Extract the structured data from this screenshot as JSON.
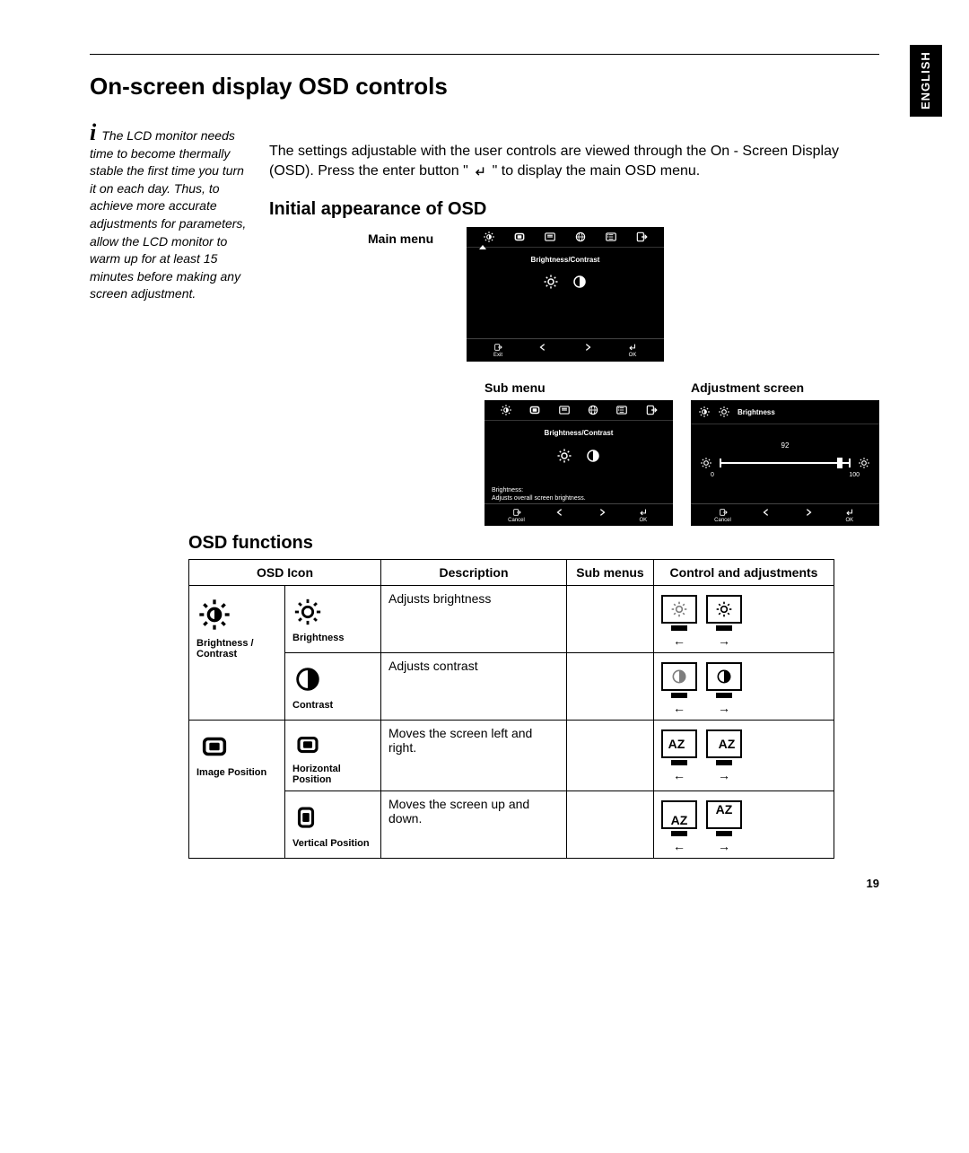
{
  "lang_tab": "ENGLISH",
  "page_title": "On-screen display OSD controls",
  "sidebar_note": "The LCD monitor needs time to become thermally stable the first time you turn it on each day. Thus, to achieve more accurate adjustments for parameters, allow the LCD monitor to warm up for  at least 15 minutes before making any screen adjustment.",
  "intro_text_1": "The settings adjustable with the user controls are viewed through the On - Screen Display (OSD). Press the enter button \" ",
  "intro_text_2": " \" to display the main OSD menu.",
  "section_initial": "Initial appearance of OSD",
  "label_main_menu": "Main menu",
  "label_sub_menu": "Sub menu",
  "label_adjustment": "Adjustment screen",
  "osd_main": {
    "title": "Brightness/Contrast",
    "exit": "Exit",
    "ok": "OK"
  },
  "osd_sub": {
    "title": "Brightness/Contrast",
    "help1": "Brightness:",
    "help2": "Adjusts overall screen brightness.",
    "cancel": "Cancel",
    "ok": "OK"
  },
  "osd_adj": {
    "title": "Brightness",
    "value": "92",
    "min": "0",
    "max": "100",
    "cancel": "Cancel",
    "ok": "OK"
  },
  "section_functions": "OSD functions",
  "table": {
    "h1": "OSD Icon",
    "h2": "Description",
    "h3": "Sub menus",
    "h4": "Control and adjustments",
    "rows": [
      {
        "group": "Brightness / Contrast",
        "sub": "Brightness",
        "desc": "Adjusts brightness"
      },
      {
        "sub": "Contrast",
        "desc": "Adjusts contrast"
      },
      {
        "group": "Image Position",
        "sub": "Horizontal Position",
        "desc": "Moves the screen left and right."
      },
      {
        "sub": "Vertical Position",
        "desc": "Moves the screen up and down."
      }
    ]
  },
  "page_number": "19"
}
